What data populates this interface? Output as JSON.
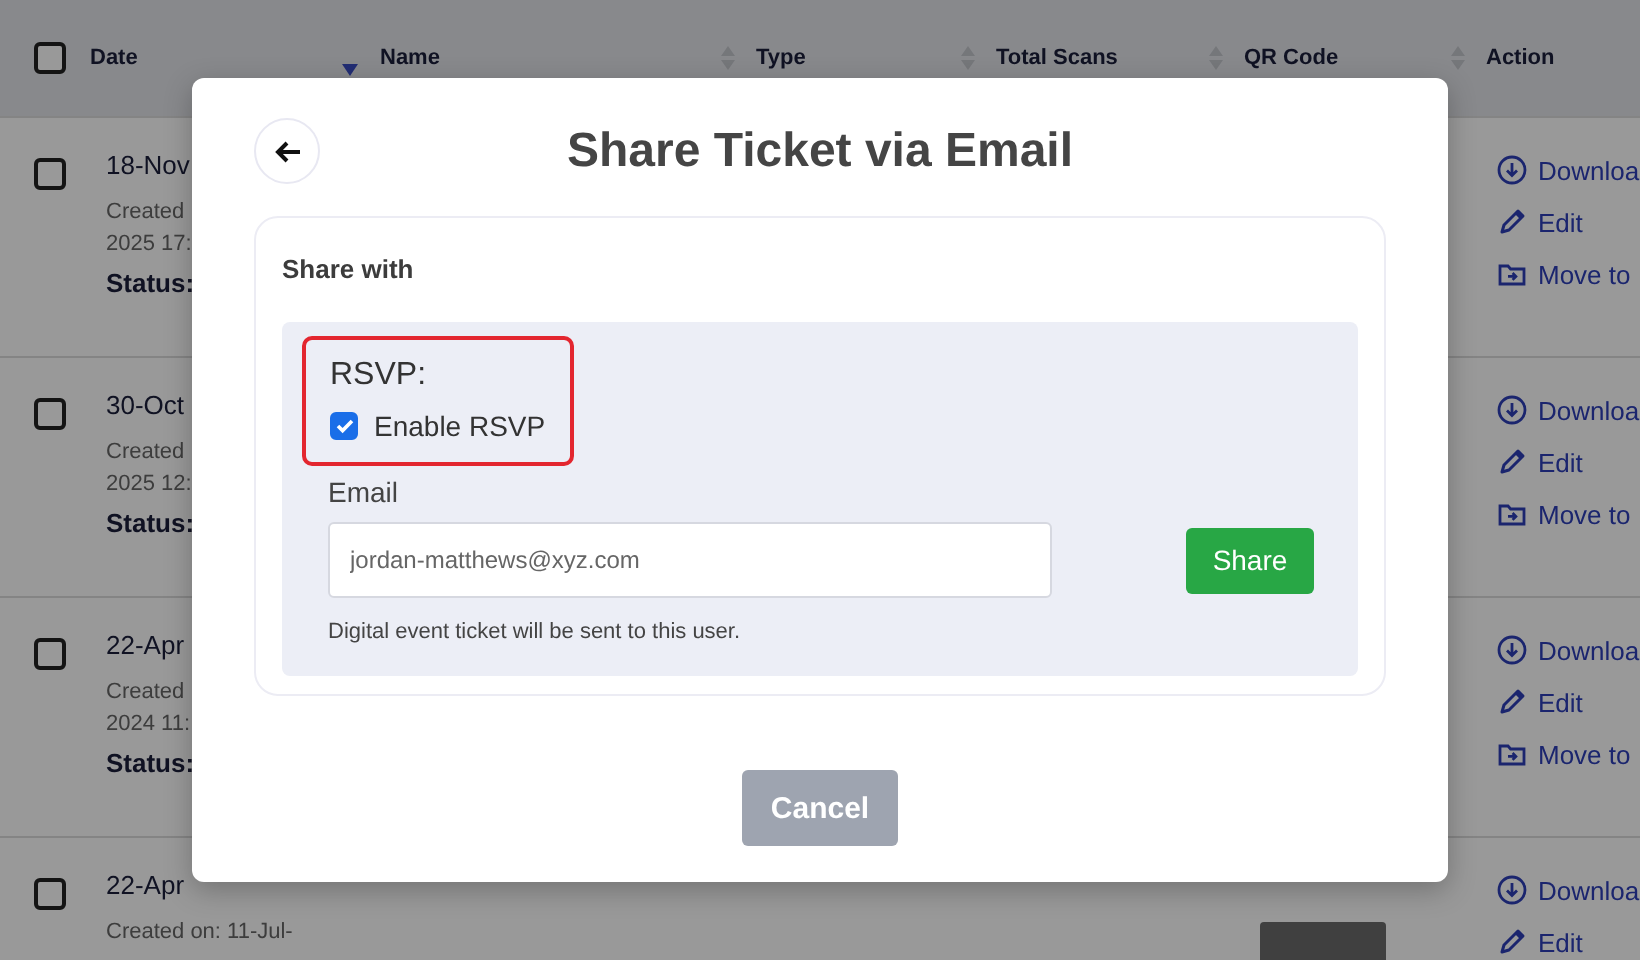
{
  "table": {
    "select_all": {
      "checked": false
    },
    "columns": [
      {
        "label": "Date",
        "sorted": true
      },
      {
        "label": "Name",
        "sorted": false
      },
      {
        "label": "Type",
        "sorted": false
      },
      {
        "label": "Total Scans",
        "sorted": false
      },
      {
        "label": "QR Code",
        "sorted": false
      },
      {
        "label": "Action"
      }
    ],
    "rows": [
      {
        "selected": false,
        "date": "18-Nov",
        "created": [
          "Created",
          "2025 17:"
        ],
        "status": "Status:",
        "actions": [
          {
            "kind": "download",
            "label": "Downloa"
          },
          {
            "kind": "edit",
            "label": "Edit"
          },
          {
            "kind": "move",
            "label": "Move to"
          }
        ]
      },
      {
        "selected": false,
        "date": "30-Oct",
        "created": [
          "Created",
          "2025 12:"
        ],
        "status": "Status:",
        "actions": [
          {
            "kind": "download",
            "label": "Downloa"
          },
          {
            "kind": "edit",
            "label": "Edit"
          },
          {
            "kind": "move",
            "label": "Move to"
          }
        ]
      },
      {
        "selected": false,
        "date": "22-Apr",
        "created": [
          "Created",
          "2024 11:"
        ],
        "status": "Status:",
        "actions": [
          {
            "kind": "download",
            "label": "Downloa"
          },
          {
            "kind": "edit",
            "label": "Edit"
          },
          {
            "kind": "move",
            "label": "Move to"
          }
        ]
      },
      {
        "selected": false,
        "date": "22-Apr",
        "created": [
          "Created on: 11-Jul-"
        ],
        "qr_image": true,
        "actions": [
          {
            "kind": "download",
            "label": "Downloa"
          },
          {
            "kind": "edit",
            "label": "Edit"
          }
        ]
      }
    ]
  },
  "dialog": {
    "title": "Share Ticket via Email",
    "section_title": "Share with",
    "rsvp": {
      "label": "RSVP:",
      "option": "Enable RSVP",
      "checked": true,
      "highlighted": true
    },
    "email": {
      "label": "Email",
      "value": "jordan-matthews@xyz.com",
      "help": "Digital event ticket will be sent to this user."
    },
    "share_button": "Share",
    "cancel_button": "Cancel"
  }
}
